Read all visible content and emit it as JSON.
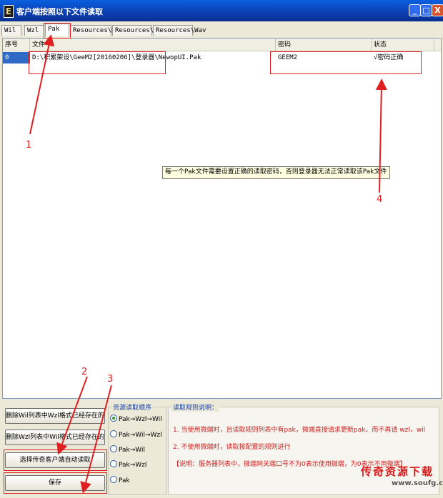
{
  "window": {
    "title": "客户端按照以下文件读取",
    "app_icon": "E",
    "controls": [
      "_",
      "□",
      "X"
    ]
  },
  "tabs": [
    {
      "label": "Wil",
      "active": false
    },
    {
      "label": "Wzl",
      "active": false
    },
    {
      "label": "Pak",
      "active": true
    },
    {
      "label": "Resources\\Data",
      "active": false
    },
    {
      "label": "Resources\\Map",
      "active": false
    },
    {
      "label": "Resources\\Wav",
      "active": false
    }
  ],
  "table": {
    "columns": [
      "序号",
      "文件",
      "密码",
      "状态"
    ],
    "rows": [
      {
        "index": "0",
        "file": "D:\\积累架设\\GeeM2[20160206]\\登录器\\NewopUI.Pak",
        "password": "GEEM2",
        "status": "√密码正确"
      }
    ]
  },
  "tooltip": "每一个Pak文件需要设置正确的读取密码，否则登录器无法正常读取该Pak文件",
  "annotations": [
    "1",
    "2",
    "3",
    "4"
  ],
  "buttons": {
    "delete_wil": "删除Wil列表中Wzl格式已经存在的文件",
    "delete_wzl": "删除Wzl列表中Wil格式已经存在的文件",
    "auto_read": "选择传奇客户端自动读取",
    "save": "保存"
  },
  "resource_order": {
    "title": "资源读取顺序",
    "options": [
      {
        "label": "Pak→Wzl→Wil",
        "selected": true
      },
      {
        "label": "Pak→Wil→Wzl",
        "selected": false
      },
      {
        "label": "Pak→Wil",
        "selected": false
      },
      {
        "label": "Pak→Wzl",
        "selected": false
      },
      {
        "label": "Pak",
        "selected": false
      }
    ]
  },
  "rules": {
    "title": "读取规则说明：",
    "lines": [
      "1. 当使用微端时，且读取规则列表中有pak，微端直接请求更新pak，而不再请 wzl，wil",
      "2. 不使用微端时，读取按配置的规则进行",
      "【说明：服务器列表中，微端网关端口号不为0表示使用微端，为0表示不用微端】"
    ]
  },
  "watermark": {
    "text": "传奇资源下载",
    "url": "www.soufg.com"
  },
  "colors": {
    "title_bar": "#0b3fb0",
    "annotation": "#e02020",
    "rule_text": "#d02020"
  }
}
